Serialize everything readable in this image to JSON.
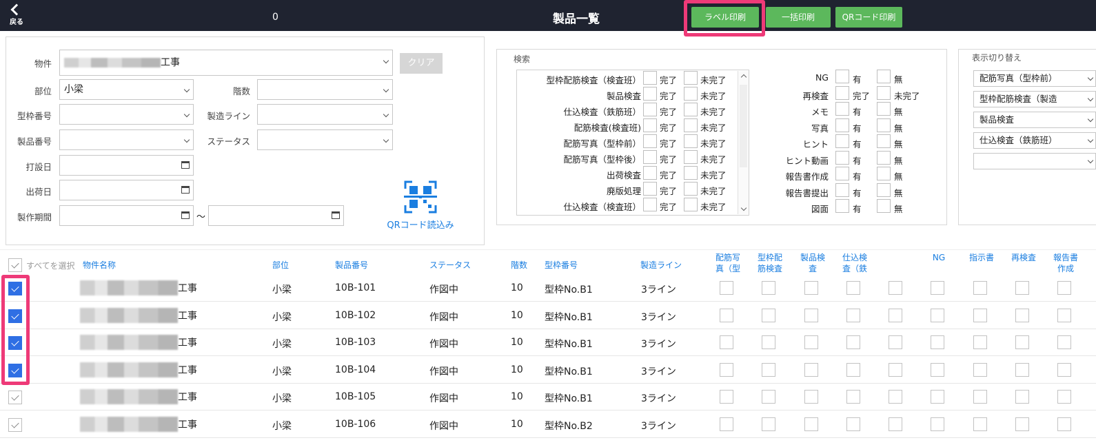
{
  "header": {
    "back_label": "戻る",
    "counter": "0",
    "title": "製品一覧",
    "buttons": [
      "ラベル印刷",
      "一括印刷",
      "QRコード印刷"
    ]
  },
  "filters": {
    "property_label": "物件",
    "property_value_suffix": "工事",
    "clear_label": "クリア",
    "part_label": "部位",
    "part_value": "小梁",
    "floors_label": "階数",
    "form_number_label": "型枠番号",
    "line_label": "製造ライン",
    "product_number_label": "製品番号",
    "status_label": "ステータス",
    "casting_date_label": "打設日",
    "shipping_date_label": "出荷日",
    "period_label": "製作期間",
    "period_sep": "〜",
    "qr_read_label": "QRコード読込み"
  },
  "search": {
    "title": "検索",
    "left_items": [
      "型枠配筋検査（検査班）",
      "製品検査",
      "仕込検査（鉄筋班）",
      "配筋検査(検査班)",
      "配筋写真（型枠前）",
      "配筋写真（型枠後）",
      "出荷検査",
      "廃版処理",
      "仕込検査（検査班）"
    ],
    "left_opts": [
      "完了",
      "未完了"
    ],
    "right_items": [
      {
        "name": "NG",
        "opts": [
          "有",
          "無"
        ]
      },
      {
        "name": "再検査",
        "opts": [
          "完了",
          "未完了"
        ]
      },
      {
        "name": "メモ",
        "opts": [
          "有",
          "無"
        ]
      },
      {
        "name": "写真",
        "opts": [
          "有",
          "無"
        ]
      },
      {
        "name": "ヒント",
        "opts": [
          "有",
          "無"
        ]
      },
      {
        "name": "ヒント動画",
        "opts": [
          "有",
          "無"
        ]
      },
      {
        "name": "報告書作成",
        "opts": [
          "有",
          "無"
        ]
      },
      {
        "name": "報告書提出",
        "opts": [
          "有",
          "無"
        ]
      },
      {
        "name": "図面",
        "opts": [
          "有",
          "無"
        ]
      }
    ]
  },
  "display_toggle": {
    "title": "表示切り替え",
    "options": [
      "配筋写真（型枠前）",
      "型枠配筋検査（製造",
      "製品検査",
      "仕込検査（鉄筋班）",
      ""
    ]
  },
  "table": {
    "select_all": "すべてを選択",
    "headers": [
      "物件名称",
      "部位",
      "製品番号",
      "ステータス",
      "階数",
      "型枠番号",
      "製造ライン"
    ],
    "check_headers": [
      [
        "配筋写",
        "真（型"
      ],
      [
        "型枠配",
        "筋検査"
      ],
      [
        "製品検",
        "査"
      ],
      [
        "仕込検",
        "査（鉄"
      ],
      [
        "",
        ""
      ],
      [
        "NG",
        ""
      ],
      [
        "指示書",
        ""
      ],
      [
        "再検査",
        ""
      ],
      [
        "報告書",
        "作成"
      ]
    ],
    "rows": [
      {
        "selected": true,
        "name_suffix": "工事",
        "part": "小梁",
        "product": "10B-101",
        "status": "作図中",
        "floor": "10",
        "form": "型枠No.B1",
        "line": "3ライン"
      },
      {
        "selected": true,
        "name_suffix": "工事",
        "part": "小梁",
        "product": "10B-102",
        "status": "作図中",
        "floor": "10",
        "form": "型枠No.B1",
        "line": "3ライン"
      },
      {
        "selected": true,
        "name_suffix": "工事",
        "part": "小梁",
        "product": "10B-103",
        "status": "作図中",
        "floor": "10",
        "form": "型枠No.B1",
        "line": "3ライン"
      },
      {
        "selected": true,
        "name_suffix": "工事",
        "part": "小梁",
        "product": "10B-104",
        "status": "作図中",
        "floor": "10",
        "form": "型枠No.B1",
        "line": "3ライン"
      },
      {
        "selected": false,
        "name_suffix": "工事",
        "part": "小梁",
        "product": "10B-105",
        "status": "作図中",
        "floor": "10",
        "form": "型枠No.B1",
        "line": "3ライン"
      },
      {
        "selected": false,
        "name_suffix": "工事",
        "part": "小梁",
        "product": "10B-106",
        "status": "作図中",
        "floor": "10",
        "form": "型枠No.B2",
        "line": "3ライン"
      }
    ]
  },
  "colors": {
    "header_bg": "#1f2330",
    "button_green": "#5cb85c",
    "highlight": "#ee3a78",
    "link_blue": "#1a7ee0",
    "check_blue": "#2f6fe4"
  }
}
